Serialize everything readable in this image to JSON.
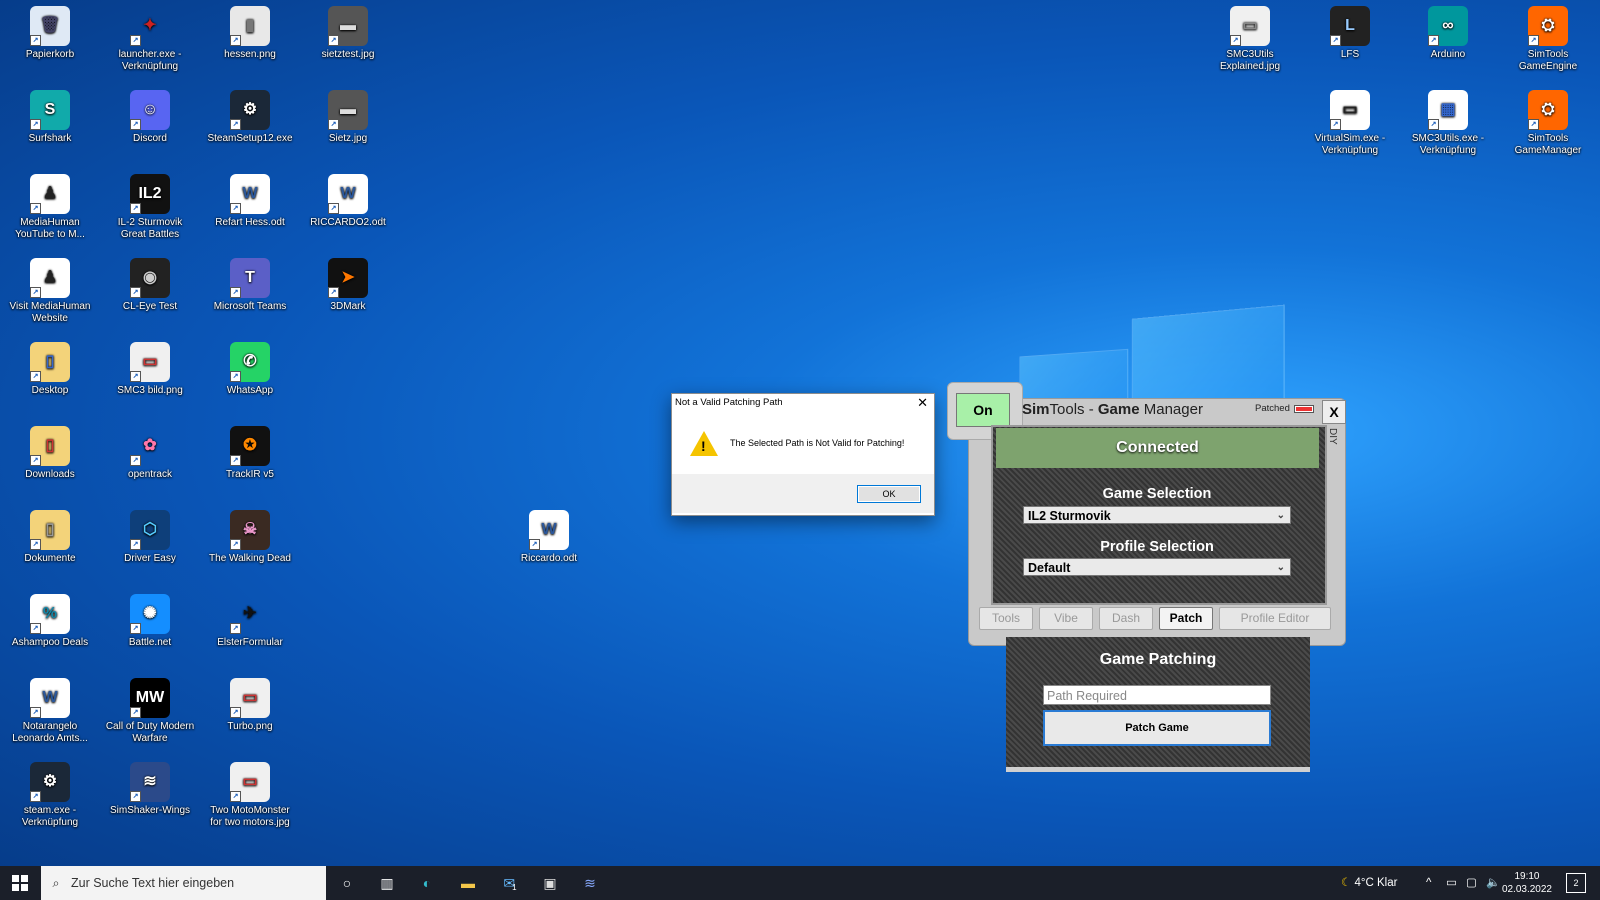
{
  "desktop": {
    "icons": [
      {
        "label": "Papierkorb",
        "glyph": "🗑",
        "bg": "#dfe9f5",
        "fg": "#446"
      },
      {
        "label": "launcher.exe - Verknüpfung",
        "glyph": "✦",
        "bg": "transparent",
        "fg": "#c22"
      },
      {
        "label": "hessen.png",
        "glyph": "▮",
        "bg": "#e8e8e8",
        "fg": "#777"
      },
      {
        "label": "sietztest.jpg",
        "glyph": "▬",
        "bg": "#555",
        "fg": "#ddd"
      },
      {
        "label": "Surfshark",
        "glyph": "S",
        "bg": "#1aa",
        "fg": "#fff"
      },
      {
        "label": "Discord",
        "glyph": "☺",
        "bg": "#5865f2",
        "fg": "#fff"
      },
      {
        "label": "SteamSetup12.exe",
        "glyph": "⚙",
        "bg": "#1b2838",
        "fg": "#fff"
      },
      {
        "label": "Sietz.jpg",
        "glyph": "▬",
        "bg": "#555",
        "fg": "#ddd"
      },
      {
        "label": "MediaHuman YouTube to M...",
        "glyph": "♟",
        "bg": "#fff",
        "fg": "#222"
      },
      {
        "label": "IL-2 Sturmovik Great Battles",
        "glyph": "IL2",
        "bg": "#111",
        "fg": "#fff"
      },
      {
        "label": "Refart Hess.odt",
        "glyph": "W",
        "bg": "#fff",
        "fg": "#2b579a"
      },
      {
        "label": "RICCARDO2.odt",
        "glyph": "W",
        "bg": "#fff",
        "fg": "#2b579a"
      },
      {
        "label": "Visit MediaHuman Website",
        "glyph": "♟",
        "bg": "#fff",
        "fg": "#222"
      },
      {
        "label": "CL-Eye Test",
        "glyph": "◉",
        "bg": "#222",
        "fg": "#ccc"
      },
      {
        "label": "Microsoft Teams",
        "glyph": "T",
        "bg": "#5b5fc7",
        "fg": "#fff"
      },
      {
        "label": "3DMark",
        "glyph": "➤",
        "bg": "#111",
        "fg": "#f70"
      },
      {
        "label": "Desktop",
        "glyph": "▯",
        "bg": "#f3d37a",
        "fg": "#36c"
      },
      {
        "label": "SMC3 bild.png",
        "glyph": "▭",
        "bg": "#f0f0f0",
        "fg": "#c33"
      },
      {
        "label": "WhatsApp",
        "glyph": "✆",
        "bg": "#25d366",
        "fg": "#fff"
      },
      {
        "label": "Downloads",
        "glyph": "▯",
        "bg": "#f3d37a",
        "fg": "#c33"
      },
      {
        "label": "opentrack",
        "glyph": "✿",
        "bg": "transparent",
        "fg": "#f7a"
      },
      {
        "label": "TrackIR v5",
        "glyph": "✪",
        "bg": "#111",
        "fg": "#f80"
      },
      {
        "label": "Dokumente",
        "glyph": "▯",
        "bg": "#f3d37a",
        "fg": "#999"
      },
      {
        "label": "Driver Easy",
        "glyph": "⬡",
        "bg": "#0e3f7a",
        "fg": "#5cf"
      },
      {
        "label": "The Walking Dead",
        "glyph": "☠",
        "bg": "#3a2a22",
        "fg": "#e9c"
      },
      {
        "label": "Ashampoo Deals",
        "glyph": "%",
        "bg": "#fff",
        "fg": "#18a"
      },
      {
        "label": "Battle.net",
        "glyph": "✺",
        "bg": "#148eff",
        "fg": "#fff"
      },
      {
        "label": "ElsterFormular",
        "glyph": "✈",
        "bg": "transparent",
        "fg": "#111"
      },
      {
        "label": "Notarangelo Leonardo Amts...",
        "glyph": "W",
        "bg": "#fff",
        "fg": "#2b579a"
      },
      {
        "label": "Call of Duty Modern Warfare",
        "glyph": "MW",
        "bg": "#000",
        "fg": "#fff"
      },
      {
        "label": "Turbo.png",
        "glyph": "▭",
        "bg": "#f0f0f0",
        "fg": "#c33"
      },
      {
        "label": "steam.exe - Verknüpfung",
        "glyph": "⚙",
        "bg": "#1b2838",
        "fg": "#fff"
      },
      {
        "label": "SimShaker-Wings",
        "glyph": "≋",
        "bg": "#2b4a8a",
        "fg": "#fff"
      },
      {
        "label": "Two MotoMonster for two motors.jpg",
        "glyph": "▭",
        "bg": "#f0f0f0",
        "fg": "#c33"
      },
      {
        "label": "Riccardo.odt",
        "glyph": "W",
        "bg": "#fff",
        "fg": "#2b579a"
      },
      {
        "label": "SMC3Utils Explained.jpg",
        "glyph": "▭",
        "bg": "#f0f0f0",
        "fg": "#888"
      },
      {
        "label": "LFS",
        "glyph": "L",
        "bg": "#222",
        "fg": "#9cf"
      },
      {
        "label": "Arduino",
        "glyph": "∞",
        "bg": "#00979d",
        "fg": "#fff"
      },
      {
        "label": "SimTools GameEngine",
        "glyph": "⛭",
        "bg": "#f60",
        "fg": "#fff"
      },
      {
        "label": "VirtualSim.exe - Verknüpfung",
        "glyph": "▭",
        "bg": "#fff",
        "fg": "#222"
      },
      {
        "label": "SMC3Utils.exe - Verknüpfung",
        "glyph": "▦",
        "bg": "#fff",
        "fg": "#36c"
      },
      {
        "label": "SimTools GameManager",
        "glyph": "⛭",
        "bg": "#f60",
        "fg": "#fff"
      }
    ]
  },
  "dialog": {
    "title": "Not a Valid Patching Path",
    "close": "✕",
    "warning_glyph": "!",
    "message": "The Selected Path is Not Valid for Patching!",
    "ok": "OK"
  },
  "simtools": {
    "on_button": "On",
    "title_sim": "Sim",
    "title_tools": "Tools - ",
    "title_game": "Game",
    "title_manager": " Manager",
    "patched_label": "Patched",
    "close": "X",
    "diy": "DIY",
    "status": "Connected",
    "game_selection_label": "Game Selection",
    "game_selection_value": "IL2 Sturmovik",
    "profile_selection_label": "Profile Selection",
    "profile_selection_value": "Default",
    "tabs": [
      "Tools",
      "Vibe",
      "Dash",
      "Patch",
      "Profile Editor"
    ],
    "active_tab": "Patch",
    "patch_title": "Game Patching",
    "path_placeholder": "Path Required",
    "patch_button": "Patch Game"
  },
  "taskbar": {
    "search_placeholder": "Zur Suche Text hier eingeben",
    "weather": "4°C  Klar",
    "time": "19:10",
    "date": "02.03.2022",
    "mail_badge": "1",
    "notifications": "2"
  }
}
